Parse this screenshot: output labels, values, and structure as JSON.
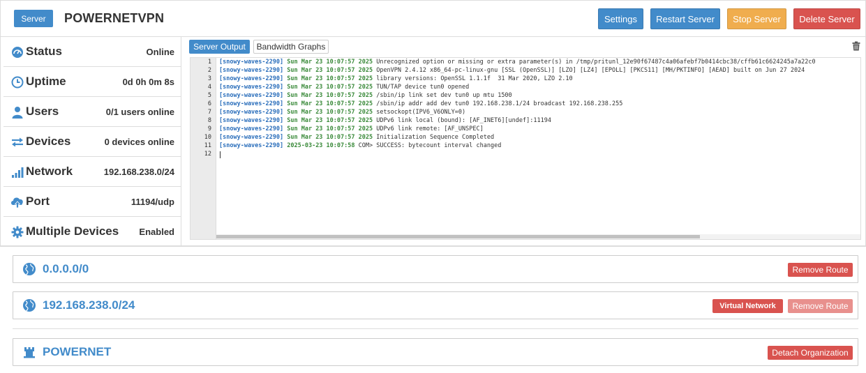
{
  "header": {
    "server_label": "Server",
    "server_name": "POWERNETVPN",
    "settings_label": "Settings",
    "restart_label": "Restart Server",
    "stop_label": "Stop Server",
    "delete_label": "Delete Server"
  },
  "status": [
    {
      "label": "Status",
      "value": "Online",
      "icon": "dashboard-icon"
    },
    {
      "label": "Uptime",
      "value": "0d 0h 0m 8s",
      "icon": "clock-icon"
    },
    {
      "label": "Users",
      "value": "0/1 users online",
      "icon": "user-icon"
    },
    {
      "label": "Devices",
      "value": "0 devices online",
      "icon": "transfer-icon"
    },
    {
      "label": "Network",
      "value": "192.168.238.0/24",
      "icon": "signal-icon"
    },
    {
      "label": "Port",
      "value": "11194/udp",
      "icon": "cloud-upload-icon"
    },
    {
      "label": "Multiple Devices",
      "value": "Enabled",
      "icon": "gear-icon"
    }
  ],
  "tabs": {
    "output_label": "Server Output",
    "bandwidth_label": "Bandwidth Graphs"
  },
  "log": [
    {
      "n": "1",
      "src": "[snowy-waves-2290]",
      "time": "Sun Mar 23 10:07:57 2025",
      "msg": "Unrecognized option or missing or extra parameter(s) in /tmp/pritunl_12e90f67487c4a06afebf7b0414cbc38/cffb61c6624245a7a22c0"
    },
    {
      "n": "2",
      "src": "[snowy-waves-2290]",
      "time": "Sun Mar 23 10:07:57 2025",
      "msg": "OpenVPN 2.4.12 x86_64-pc-linux-gnu [SSL (OpenSSL)] [LZO] [LZ4] [EPOLL] [PKCS11] [MH/PKTINFO] [AEAD] built on Jun 27 2024"
    },
    {
      "n": "3",
      "src": "[snowy-waves-2290]",
      "time": "Sun Mar 23 10:07:57 2025",
      "msg": "library versions: OpenSSL 1.1.1f  31 Mar 2020, LZO 2.10"
    },
    {
      "n": "4",
      "src": "[snowy-waves-2290]",
      "time": "Sun Mar 23 10:07:57 2025",
      "msg": "TUN/TAP device tun0 opened"
    },
    {
      "n": "5",
      "src": "[snowy-waves-2290]",
      "time": "Sun Mar 23 10:07:57 2025",
      "msg": "/sbin/ip link set dev tun0 up mtu 1500"
    },
    {
      "n": "6",
      "src": "[snowy-waves-2290]",
      "time": "Sun Mar 23 10:07:57 2025",
      "msg": "/sbin/ip addr add dev tun0 192.168.238.1/24 broadcast 192.168.238.255"
    },
    {
      "n": "7",
      "src": "[snowy-waves-2290]",
      "time": "Sun Mar 23 10:07:57 2025",
      "msg": "setsockopt(IPV6_V6ONLY=0)"
    },
    {
      "n": "8",
      "src": "[snowy-waves-2290]",
      "time": "Sun Mar 23 10:07:57 2025",
      "msg": "UDPv6 link local (bound): [AF_INET6][undef]:11194"
    },
    {
      "n": "9",
      "src": "[snowy-waves-2290]",
      "time": "Sun Mar 23 10:07:57 2025",
      "msg": "UDPv6 link remote: [AF_UNSPEC]"
    },
    {
      "n": "10",
      "src": "[snowy-waves-2290]",
      "time": "Sun Mar 23 10:07:57 2025",
      "msg": "Initialization Sequence Completed"
    },
    {
      "n": "11",
      "src": "[snowy-waves-2290]",
      "time": "2025-03-23 10:07:58",
      "msg": "COM> SUCCESS: bytecount interval changed"
    }
  ],
  "last_line_number": "12",
  "routes": [
    {
      "network": "0.0.0.0/0",
      "remove_label": "Remove Route"
    },
    {
      "network": "192.168.238.0/24",
      "virtual_label": "Virtual Network",
      "remove_label": "Remove Route"
    }
  ],
  "organization": {
    "name": "POWERNET",
    "detach_label": "Detach Organization"
  },
  "colors": {
    "primary": "#428bca",
    "warning": "#f0ad4e",
    "danger": "#d9534f",
    "danger_disabled": "#e8908d",
    "log_source": "#2a6ebb",
    "log_time": "#3a8a3a"
  }
}
